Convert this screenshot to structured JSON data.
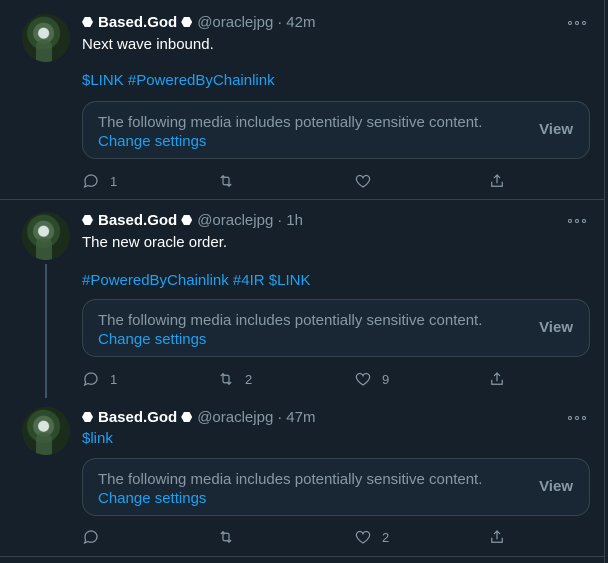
{
  "tweets": [
    {
      "name": "Based.God",
      "handle": "@oraclejpg",
      "time": "42m",
      "text_lines": [
        "Next wave inbound."
      ],
      "tags": "$LINK #PoweredByChainlink",
      "media": {
        "warning": "The following media includes potentially sensitive content.",
        "change": "Change settings",
        "view": "View"
      },
      "replies": "1",
      "retweets": "",
      "likes": ""
    },
    {
      "name": "Based.God",
      "handle": "@oraclejpg",
      "time": "1h",
      "text_lines": [
        "The new oracle order."
      ],
      "tags": "#PoweredByChainlink #4IR $LINK",
      "media": {
        "warning": "The following media includes potentially sensitive content.",
        "change": "Change settings",
        "view": "View"
      },
      "replies": "1",
      "retweets": "2",
      "likes": "9"
    },
    {
      "name": "Based.God",
      "handle": "@oraclejpg",
      "time": "47m",
      "text_lines": [
        ""
      ],
      "tags": "$link",
      "media": {
        "warning": "The following media includes potentially sensitive content.",
        "change": "Change settings",
        "view": "View"
      },
      "replies": "",
      "retweets": "",
      "likes": "2"
    }
  ],
  "icons": {
    "reply": "reply-icon",
    "retweet": "retweet-icon",
    "like": "heart-icon",
    "share": "share-icon",
    "more": "more-icon",
    "badge": "hexagon-badge-icon"
  },
  "colors": {
    "background": "#15202b",
    "accent": "#1da1f2",
    "muted": "#8899a6",
    "border": "#38444d"
  }
}
